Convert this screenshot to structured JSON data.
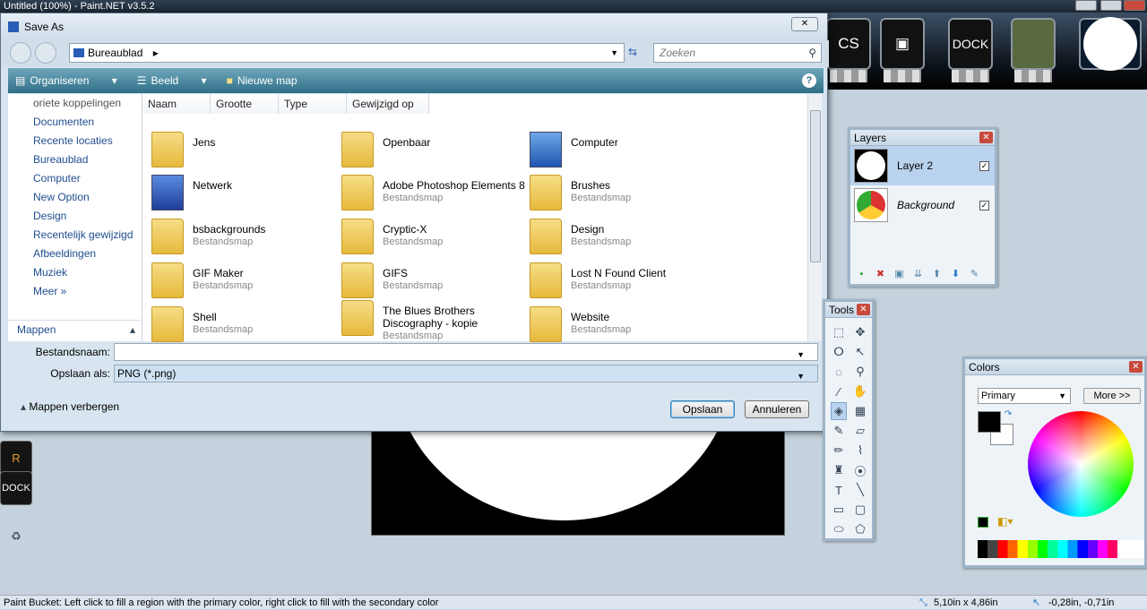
{
  "app": {
    "title": "Untitled (100%) - Paint.NET v3.5.2"
  },
  "desktop": {
    "dock_left": [
      "CS",
      "R",
      "DOCK"
    ],
    "dock_top": [
      "CS",
      "DOCK"
    ]
  },
  "dialog": {
    "title": "Save As",
    "address": "Bureaublad",
    "search_placeholder": "Zoeken",
    "toolbar": {
      "organize": "Organiseren",
      "view": "Beeld",
      "new_folder": "Nieuwe map"
    },
    "nav": {
      "items": [
        "oriete koppelingen",
        "Documenten",
        "Recente locaties",
        "Bureaublad",
        "Computer",
        "New Option",
        "Design",
        "Recentelijk gewijzigd",
        "Afbeeldingen",
        "Muziek",
        "Meer »"
      ],
      "folders_label": "Mappen"
    },
    "columns": [
      "Naam",
      "Grootte",
      "Type",
      "Gewijzigd op"
    ],
    "files": [
      {
        "name": "Jens",
        "type": ""
      },
      {
        "name": "Openbaar",
        "type": ""
      },
      {
        "name": "Computer",
        "type": ""
      },
      {
        "name": "Netwerk",
        "type": ""
      },
      {
        "name": "Adobe Photoshop Elements 8",
        "type": "Bestandsmap"
      },
      {
        "name": "Brushes",
        "type": "Bestandsmap"
      },
      {
        "name": "bsbackgrounds",
        "type": "Bestandsmap"
      },
      {
        "name": "Cryptic-X",
        "type": "Bestandsmap"
      },
      {
        "name": "Design",
        "type": "Bestandsmap"
      },
      {
        "name": "GIF Maker",
        "type": "Bestandsmap"
      },
      {
        "name": "GIFS",
        "type": "Bestandsmap"
      },
      {
        "name": "Lost N Found Client",
        "type": "Bestandsmap"
      },
      {
        "name": "Shell",
        "type": "Bestandsmap"
      },
      {
        "name": "The Blues Brothers Discography - kopie",
        "type": "Bestandsmap"
      },
      {
        "name": "Website",
        "type": "Bestandsmap"
      }
    ],
    "filename_label": "Bestandsnaam:",
    "filename_value": "",
    "savetype_label": "Opslaan als:",
    "savetype_value": "PNG (*.png)",
    "hide_folders": "Mappen verbergen",
    "save_button": "Opslaan",
    "cancel_button": "Annuleren"
  },
  "layers": {
    "title": "Layers",
    "items": [
      {
        "name": "Layer 2",
        "visible": true
      },
      {
        "name": "Background",
        "visible": true
      }
    ]
  },
  "tools": {
    "title": "Tools"
  },
  "colors": {
    "title": "Colors",
    "mode": "Primary",
    "more": "More >>"
  },
  "status": {
    "hint": "Paint Bucket: Left click to fill a region with the primary color, right click to fill with the secondary color",
    "size": "5,10in x 4,86in",
    "coords": "-0,28in, -0,71in"
  }
}
